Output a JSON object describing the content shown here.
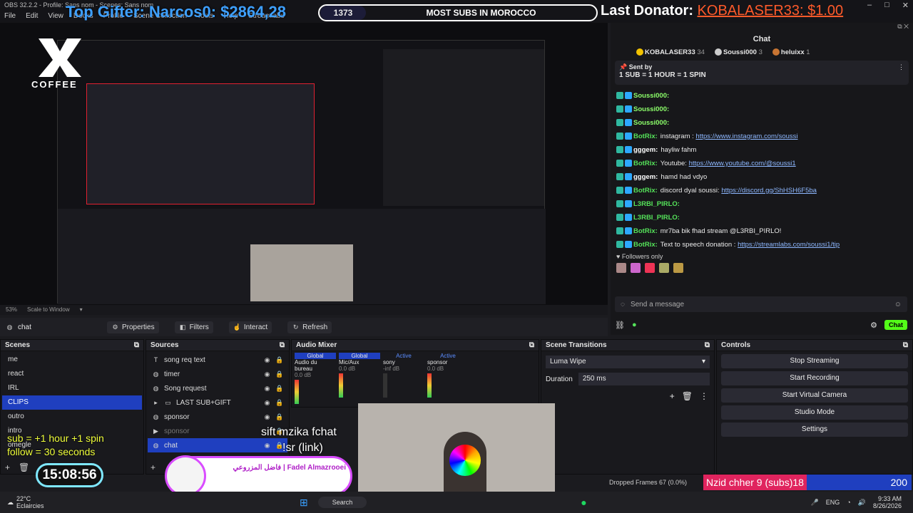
{
  "window": {
    "title": "OBS 32.2.2 - Profile: Sans nom - Scenes: Sans nom",
    "menu": [
      "File",
      "Edit",
      "View",
      "Docks",
      "Profile",
      "Scene Collection",
      "Tools",
      "Help",
      "Streamlabs"
    ],
    "controls": [
      "–",
      "□",
      "✕"
    ]
  },
  "overlay": {
    "top_gifter": "Top Gifter: Narcos0: $2864,28",
    "sub_count": "1373",
    "sub_text": "MOST SUBS IN MOROCCO",
    "last_donator_label": "Last Donator:",
    "last_donator_value": "KOBALASER33: $1.00",
    "sub_info_line1": "sub  = +1 hour +1 spin",
    "sub_info_line2": "follow = 30 seconds",
    "clock": "15:08:56",
    "song_line1": "sift mzika fchat",
    "song_line2": "!sr (link)",
    "fadel_name": "فاضل المزروعي | Fadel Almazrooei",
    "nzid_label": "Nzid chher 9 (subs)18",
    "nzid_count": "200",
    "brand_logo_text": "COFFEE"
  },
  "preview": {
    "zoom": "53%",
    "scale_mode": "Scale to Window"
  },
  "source_toolbar": {
    "source_name": "chat",
    "properties": "Properties",
    "filters": "Filters",
    "interact": "Interact",
    "refresh": "Refresh"
  },
  "scenes": {
    "title": "Scenes",
    "items": [
      "me",
      "react",
      "IRL",
      "CLIPS",
      "outro",
      "intro",
      "omegle"
    ],
    "selected": "CLIPS"
  },
  "sources": {
    "title": "Sources",
    "items": [
      {
        "name": "song req text",
        "icon": "text-icon"
      },
      {
        "name": "timer",
        "icon": "globe-icon"
      },
      {
        "name": "Song request",
        "icon": "globe-icon"
      },
      {
        "name": "LAST SUB+GIFT",
        "icon": "folder-icon"
      },
      {
        "name": "sponsor",
        "icon": "globe-icon"
      },
      {
        "name": "sponsor",
        "icon": "play-icon"
      },
      {
        "name": "chat",
        "icon": "globe-icon"
      }
    ],
    "selected": "chat"
  },
  "audio_mixer": {
    "title": "Audio Mixer",
    "channels": [
      {
        "name": "Audio du bureau",
        "tag": "Global",
        "level": "0.0 dB"
      },
      {
        "name": "Mic/Aux",
        "tag": "Global",
        "level": "0.0 dB"
      },
      {
        "name": "sony",
        "tag": "Active",
        "level": "-inf dB"
      },
      {
        "name": "sponsor",
        "tag": "Active",
        "level": "0.0 dB"
      }
    ]
  },
  "transitions": {
    "title": "Scene Transitions",
    "selected": "Luma Wipe",
    "duration_label": "Duration",
    "duration_value": "250 ms"
  },
  "controls": {
    "title": "Controls",
    "buttons": [
      "Stop Streaming",
      "Start Recording",
      "Start Virtual Camera",
      "Studio Mode",
      "Settings"
    ]
  },
  "chat": {
    "title": "Chat",
    "top_users": [
      {
        "name": "KOBALASER33",
        "count": "34"
      },
      {
        "name": "Soussi000",
        "count": "3"
      },
      {
        "name": "heluixx",
        "count": "1"
      }
    ],
    "pinned_by": "Sent by",
    "pinned_msg": "1 SUB = 1 HOUR = 1 SPIN",
    "messages": [
      {
        "user": "Soussi000:",
        "color": "#8cff6a",
        "text": "",
        "link": ""
      },
      {
        "user": "Soussi000:",
        "color": "#8cff6a",
        "text": "",
        "link": ""
      },
      {
        "user": "Soussi000:",
        "color": "#8cff6a",
        "text": "",
        "link": ""
      },
      {
        "user": "BotRix:",
        "color": "#55e35a",
        "text": "instagram : ",
        "link": "https://www.instagram.com/soussi"
      },
      {
        "user": "gggem:",
        "color": "#ffffff",
        "text": "hayliw fahm",
        "link": ""
      },
      {
        "user": "BotRix:",
        "color": "#55e35a",
        "text": "Youtube: ",
        "link": "https://www.youtube.com/@soussi1"
      },
      {
        "user": "gggem:",
        "color": "#ffffff",
        "text": "hamd had vdyo",
        "link": ""
      },
      {
        "user": "BotRix:",
        "color": "#55e35a",
        "text": "discord dyal soussi: ",
        "link": "https://discord.gg/ShHSH6F5ba"
      },
      {
        "user": "L3RBI_PIRLO:",
        "color": "#55e35a",
        "text": "",
        "link": ""
      },
      {
        "user": "L3RBI_PIRLO:",
        "color": "#55e35a",
        "text": "",
        "link": ""
      },
      {
        "user": "BotRix:",
        "color": "#55e35a",
        "text": "mr7ba bik fhad stream @L3RBI_PIRLO!",
        "link": ""
      },
      {
        "user": "BotRix:",
        "color": "#55e35a",
        "text": "Text to speech donation : ",
        "link": "https://streamlabs.com/soussi1/tip"
      }
    ],
    "followers_only": "Followers only",
    "input_placeholder": "Send a message",
    "send_button": "Chat"
  },
  "status": {
    "dropped_frames": "Dropped Frames 67 (0.0%)"
  },
  "taskbar": {
    "weather_temp": "22°C",
    "weather_desc": "Eclaircies",
    "search": "Search",
    "lang": "ENG",
    "time": "9:33 AM",
    "date": "8/26/2026"
  }
}
